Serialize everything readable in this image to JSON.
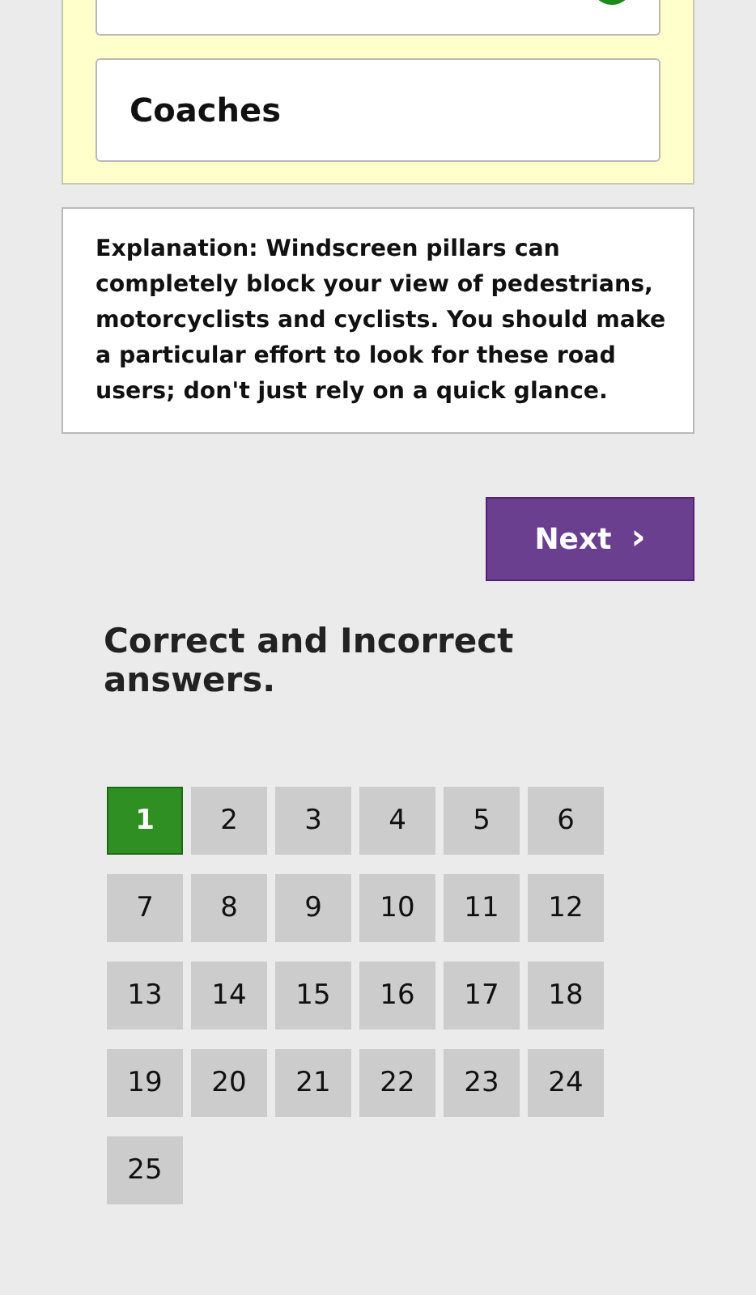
{
  "answers": [
    {
      "correct": true
    },
    {
      "label": "Coaches",
      "correct": false
    }
  ],
  "explanation": "Explanation: Windscreen pillars can completely block your view of pedestrians, motorcyclists and cyclists. You should make a particular effort to look for these road users; don't just rely on a quick glance.",
  "next_button": {
    "label": "Next",
    "icon": "›"
  },
  "results_heading": "Correct and Incorrect answers.",
  "questions": [
    {
      "number": "1",
      "correct": true
    },
    {
      "number": "2",
      "correct": false
    },
    {
      "number": "3",
      "correct": false
    },
    {
      "number": "4",
      "correct": false
    },
    {
      "number": "5",
      "correct": false
    },
    {
      "number": "6",
      "correct": false
    },
    {
      "number": "7",
      "correct": false
    },
    {
      "number": "8",
      "correct": false
    },
    {
      "number": "9",
      "correct": false
    },
    {
      "number": "10",
      "correct": false
    },
    {
      "number": "11",
      "correct": false
    },
    {
      "number": "12",
      "correct": false
    },
    {
      "number": "13",
      "correct": false
    },
    {
      "number": "14",
      "correct": false
    },
    {
      "number": "15",
      "correct": false
    },
    {
      "number": "16",
      "correct": false
    },
    {
      "number": "17",
      "correct": false
    },
    {
      "number": "18",
      "correct": false
    },
    {
      "number": "19",
      "correct": false
    },
    {
      "number": "20",
      "correct": false
    },
    {
      "number": "21",
      "correct": false
    },
    {
      "number": "22",
      "correct": false
    },
    {
      "number": "23",
      "correct": false
    },
    {
      "number": "24",
      "correct": false
    },
    {
      "number": "25",
      "correct": false
    }
  ]
}
